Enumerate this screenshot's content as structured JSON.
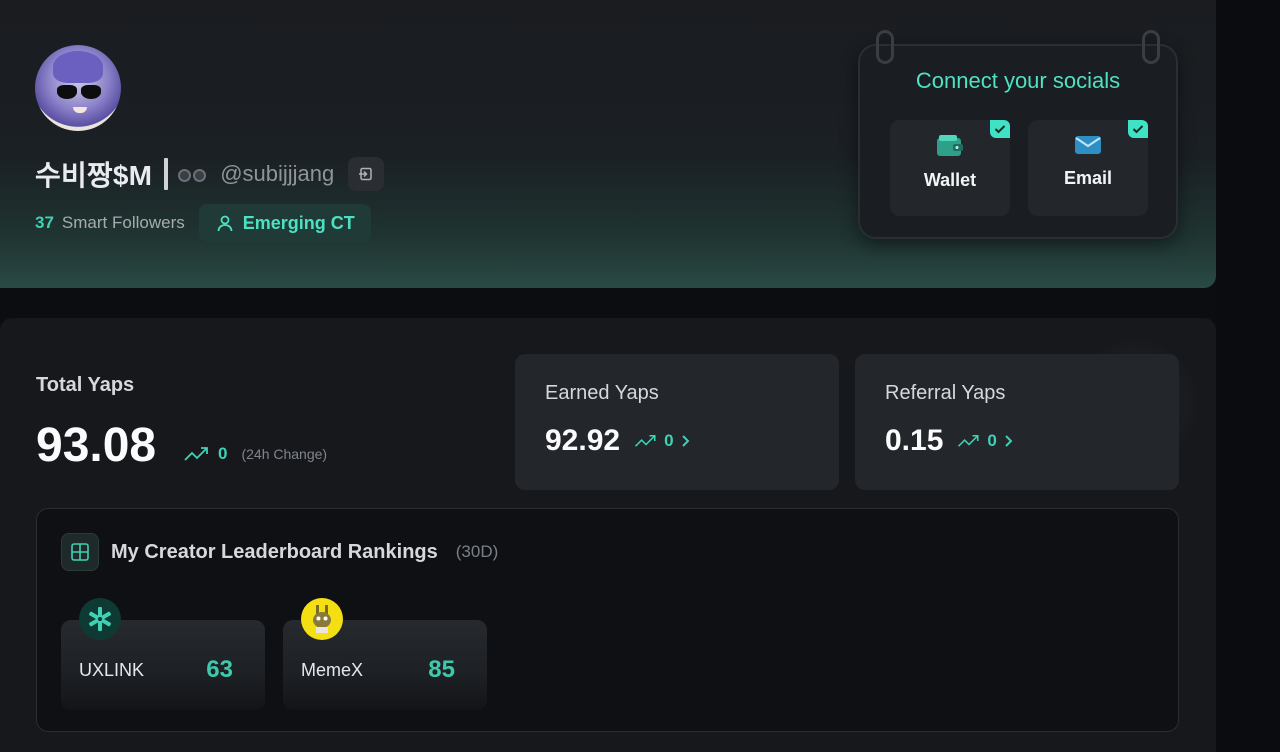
{
  "profile": {
    "display_name": "수비짱$M",
    "handle": "@subijjjang",
    "smart_followers_count": "37",
    "smart_followers_label": "Smart Followers",
    "badge_label": "Emerging CT"
  },
  "socials": {
    "title": "Connect your socials",
    "items": [
      {
        "label": "Wallet",
        "icon": "wallet-icon",
        "connected": true
      },
      {
        "label": "Email",
        "icon": "mail-icon",
        "connected": true
      }
    ]
  },
  "yaps": {
    "total_label": "Total Yaps",
    "total_value": "93.08",
    "total_change": "0",
    "change_label": "(24h Change)",
    "earned_label": "Earned Yaps",
    "earned_value": "92.92",
    "earned_change": "0",
    "referral_label": "Referral Yaps",
    "referral_value": "0.15",
    "referral_change": "0"
  },
  "rankings": {
    "title": "My Creator Leaderboard Rankings",
    "period": "(30D)",
    "items": [
      {
        "name": "UXLINK",
        "score": "63"
      },
      {
        "name": "MemeX",
        "score": "85"
      }
    ]
  },
  "colors": {
    "accent": "#3fd1b5",
    "background": "#0c0d10",
    "card": "#23262b"
  }
}
